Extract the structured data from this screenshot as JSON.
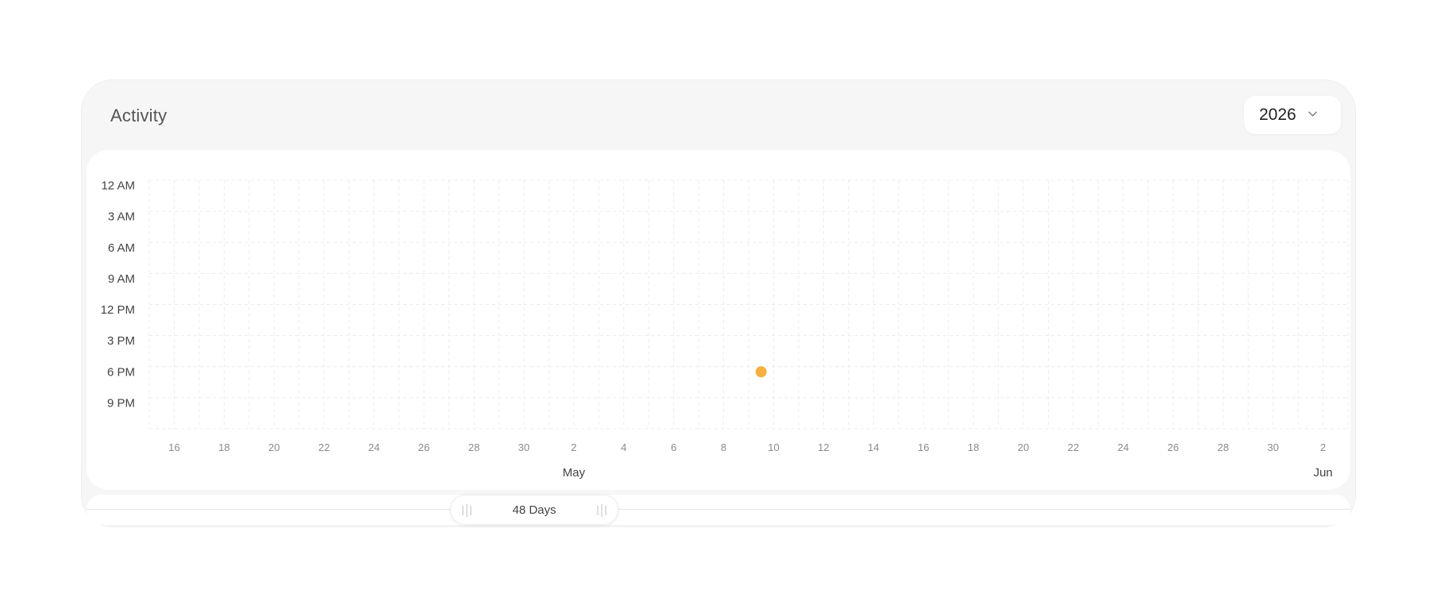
{
  "card": {
    "title": "Activity"
  },
  "year_select": {
    "value": "2026",
    "icon": "chevron-down-icon"
  },
  "range": {
    "label": "48 Days",
    "left_grip_icon": "grip-icon",
    "right_grip_icon": "grip-icon"
  },
  "chart_data": {
    "type": "scatter",
    "title": "",
    "y_ticks": [
      "12 AM",
      "3 AM",
      "6 AM",
      "9 AM",
      "12 PM",
      "3 PM",
      "6 PM",
      "9 PM"
    ],
    "x_ticks": [
      "16",
      "18",
      "20",
      "22",
      "24",
      "26",
      "28",
      "30",
      "2",
      "4",
      "6",
      "8",
      "10",
      "12",
      "14",
      "16",
      "18",
      "20",
      "22",
      "24",
      "26",
      "28",
      "30",
      "2"
    ],
    "x_month_labels": [
      "May",
      "Jun"
    ],
    "x_range": [
      "2026-04-15",
      "2026-06-02"
    ],
    "y_range": [
      "12 AM",
      "12 AM"
    ],
    "grid": true,
    "points": [
      {
        "date": "2026-05-09",
        "time": "6:30 PM",
        "color": "#F5B041"
      }
    ],
    "colors": {
      "point": "#F5B041",
      "grid": "#ececec",
      "tick_text": "#8a8a8a",
      "axis_text": "#444444"
    }
  }
}
